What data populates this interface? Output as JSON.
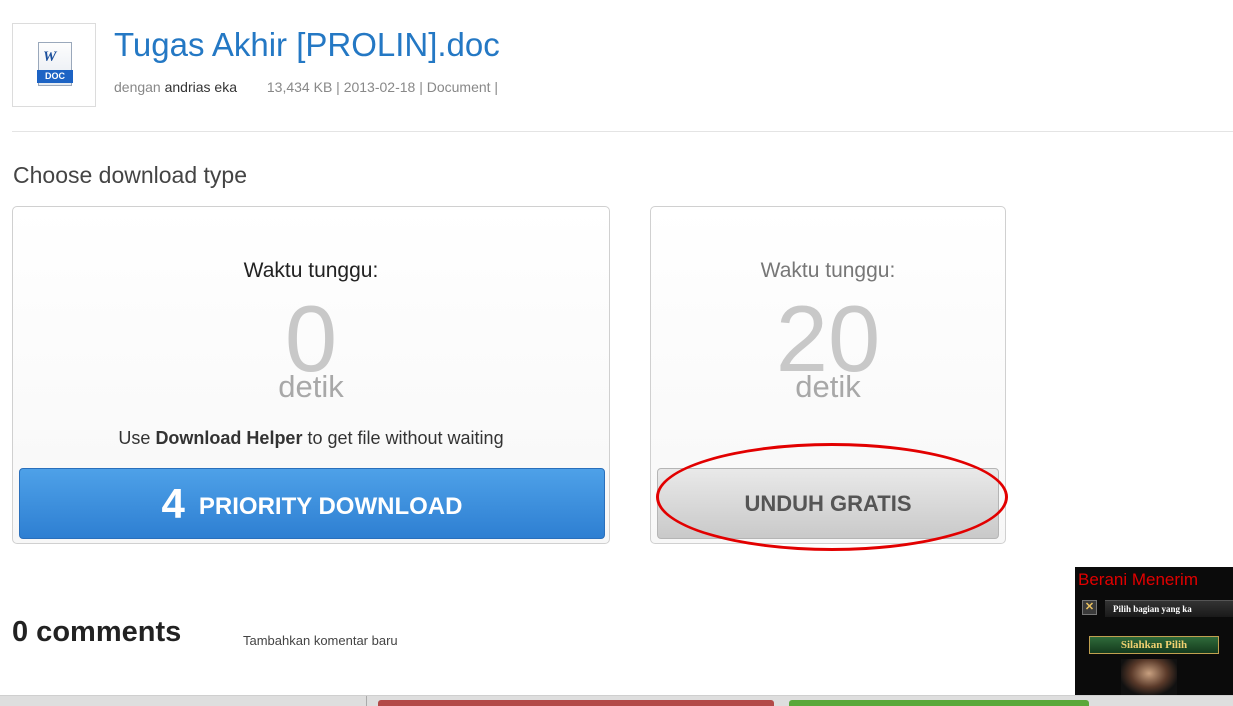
{
  "file": {
    "icon": "word-doc-icon",
    "icon_letter": "W",
    "icon_tag": "DOC",
    "title": "Tugas Akhir [PROLIN].doc",
    "by_prefix": "dengan",
    "author": "andrias eka",
    "info": "13,434 KB | 2013-02-18 | Document |"
  },
  "download": {
    "heading": "Choose download type",
    "priority": {
      "wait_label": "Waktu tunggu:",
      "seconds": "0",
      "unit": "detik",
      "helper_prefix": "Use",
      "helper_link": "Download Helper",
      "helper_suffix": "to get file without waiting",
      "button_number": "4",
      "button_label": "PRIORITY DOWNLOAD",
      "button_color": "#3a8ddd"
    },
    "free": {
      "wait_label": "Waktu tunggu:",
      "seconds": "20",
      "unit": "detik",
      "button_label": "UNDUH GRATIS",
      "highlight_color": "#e20000"
    }
  },
  "comments": {
    "title": "0 comments",
    "add_link": "Tambahkan komentar baru"
  },
  "ad": {
    "title": "Berani Menerim",
    "subtitle": "Pilih bagian yang ka",
    "button": "Silahkan Pilih",
    "close_symbol": "✕"
  }
}
